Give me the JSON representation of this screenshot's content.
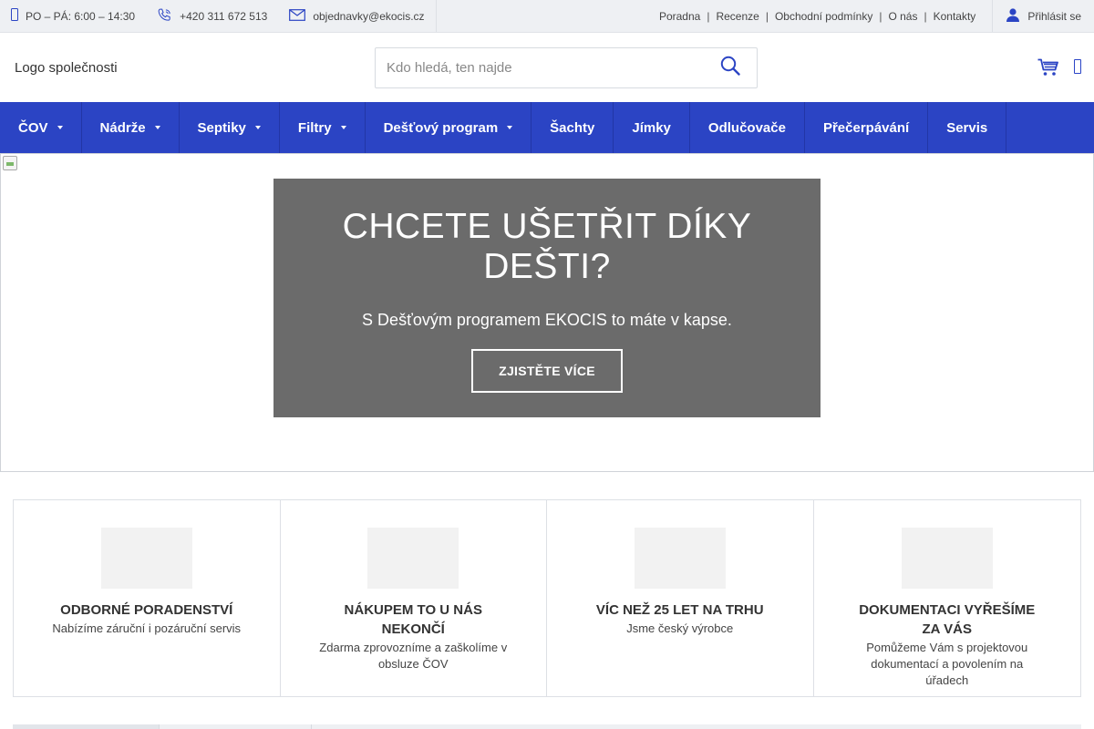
{
  "topbar": {
    "hours": "PO – PÁ: 6:00 – 14:30",
    "phone": "+420 311 672 513",
    "email": "objednavky@ekocis.cz",
    "links": [
      "Poradna",
      "Recenze",
      "Obchodní podmínky",
      "O nás",
      "Kontakty"
    ],
    "login_label": "Přihlásit se"
  },
  "header": {
    "logo_alt": "Logo společnosti",
    "search_placeholder": "Kdo hledá, ten najde"
  },
  "nav": {
    "items": [
      {
        "label": "ČOV",
        "dropdown": true
      },
      {
        "label": "Nádrže",
        "dropdown": true
      },
      {
        "label": "Septiky",
        "dropdown": true
      },
      {
        "label": "Filtry",
        "dropdown": true
      },
      {
        "label": "Dešťový program",
        "dropdown": true
      },
      {
        "label": "Šachty",
        "dropdown": false
      },
      {
        "label": "Jímky",
        "dropdown": false
      },
      {
        "label": "Odlučovače",
        "dropdown": false
      },
      {
        "label": "Přečerpávání",
        "dropdown": false
      },
      {
        "label": "Servis",
        "dropdown": false
      }
    ]
  },
  "hero": {
    "title": "CHCETE UŠETŘIT DÍKY DEŠTI?",
    "subtitle": "S Dešťovým programem EKOCIS to máte v kapse.",
    "button_label": "ZJISTĚTE VÍCE"
  },
  "benefits": [
    {
      "title": "ODBORNÉ PORADENSTVÍ",
      "text": "Nabízíme záruční i pozáruční servis"
    },
    {
      "title": "NÁKUPEM TO U NÁS NEKONČÍ",
      "text": "Zdarma zprovozníme a zaškolíme v obsluze ČOV"
    },
    {
      "title": "VÍC NEŽ 25 LET NA TRHU",
      "text": "Jsme český výrobce"
    },
    {
      "title": "DOKUMENTACI VYŘEŠÍME ZA VÁS",
      "text": "Pomůžeme Vám s projektovou dokumentací a povolením na úřadech"
    }
  ],
  "colors": {
    "brand": "#2b44c4",
    "topbar_bg": "#eef0f3",
    "hero_box": "#6b6b6b"
  }
}
